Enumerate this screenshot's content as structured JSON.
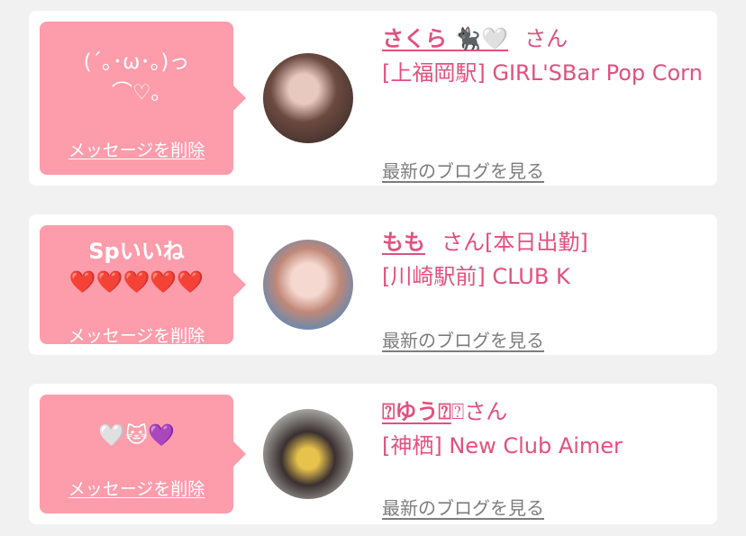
{
  "cards": [
    {
      "message": "(´｡･ω･｡)っ\n⌒♡｡",
      "delete_label": "メッセージを削除",
      "name": "さくら 🐈‍⬛🤍",
      "honorific": "さん",
      "status": "",
      "shop": "[上福岡駅] GIRL'SBar Pop Corn",
      "blog_label": "最新のブログを見る"
    },
    {
      "message": "Spいいね\n❤️❤️❤️❤️❤️",
      "delete_label": "メッセージを削除",
      "name": "もも",
      "honorific": "さん",
      "status": "[本日出勤]",
      "shop": "[川崎駅前] CLUB K",
      "blog_label": "最新のブログを見る"
    },
    {
      "message": "🤍🐱💜",
      "delete_label": "メッセージを削除",
      "name": "⍰ゆう⍰",
      "honorific": "⍰さん",
      "status": "",
      "shop": "[神栖] New Club Aimer",
      "blog_label": "最新のブログを見る"
    }
  ],
  "colors": {
    "bubble": "#fd9cab",
    "accent": "#e2507e",
    "link_gray": "#7d7d7d",
    "background": "#f1f1f1"
  }
}
